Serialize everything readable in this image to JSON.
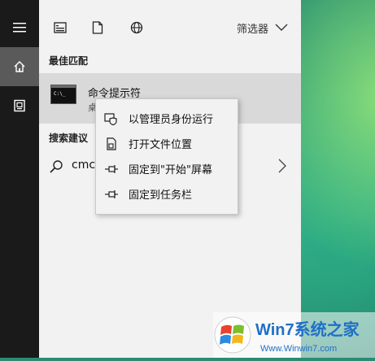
{
  "toolbar": {
    "filter_label": "筛选器"
  },
  "sections": {
    "best_match": "最佳匹配",
    "search_suggestions": "搜索建议"
  },
  "best_match_item": {
    "title": "命令提示符",
    "subtitle": "桌"
  },
  "search_suggestion": {
    "text": "cmc"
  },
  "context_menu": {
    "items": [
      {
        "label": "以管理员身份运行",
        "icon": "admin-shield-icon"
      },
      {
        "label": "打开文件位置",
        "icon": "file-location-icon"
      },
      {
        "label": "固定到\"开始\"屏幕",
        "icon": "pin-icon"
      },
      {
        "label": "固定到任务栏",
        "icon": "pin-icon"
      }
    ]
  },
  "watermark": {
    "brand": "Win7系统之家",
    "url": "Www.Winwin7.com"
  },
  "colors": {
    "panel_bg": "#f2f2f2",
    "rail_bg": "#1a1a1a",
    "rail_active": "#5a5a5a",
    "highlight": "#d9d9d9"
  }
}
